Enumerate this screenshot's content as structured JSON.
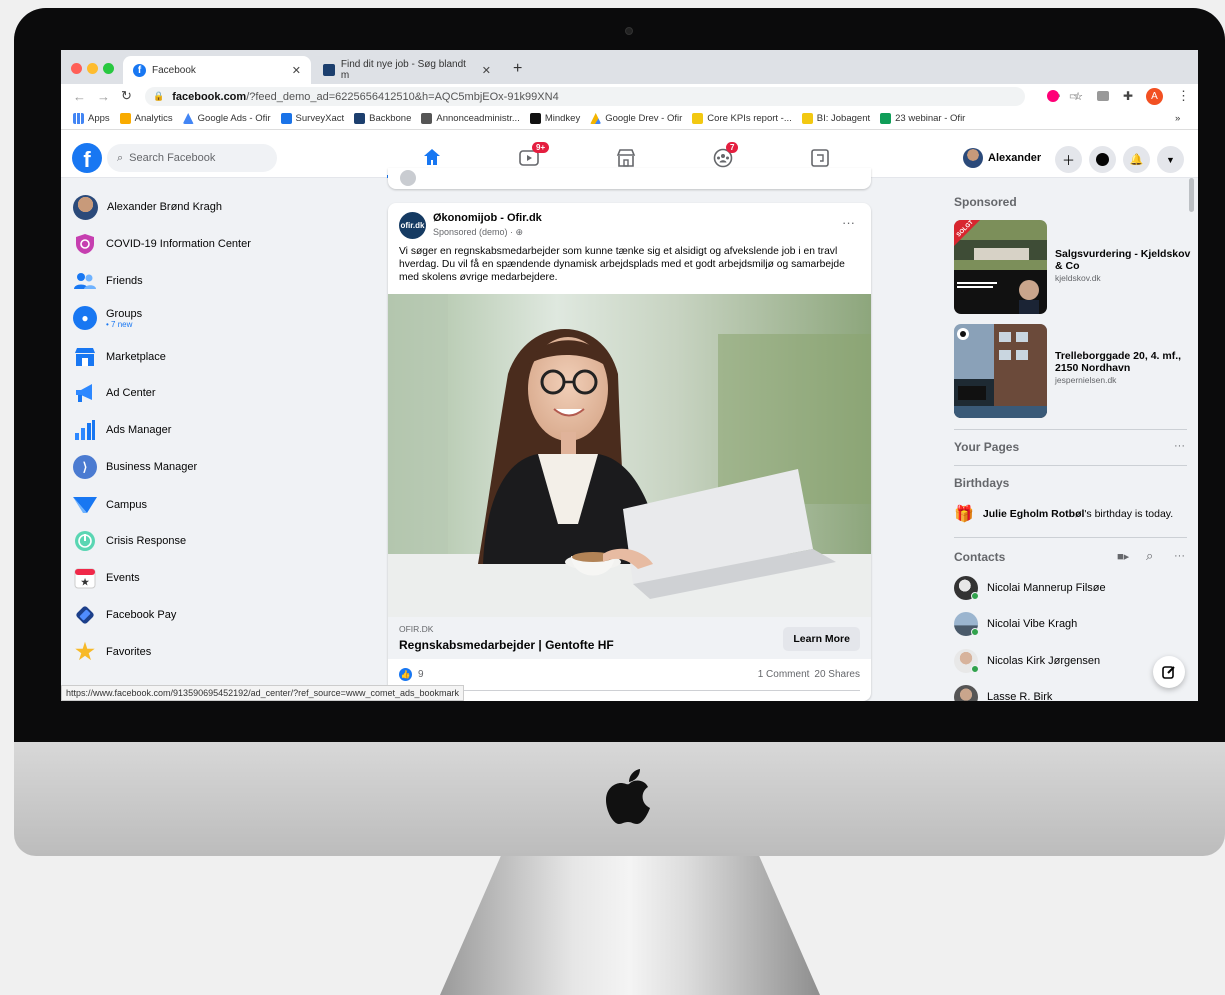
{
  "browser": {
    "tabs": [
      {
        "title": "Facebook",
        "active": true
      },
      {
        "title": "Find dit nye job - Søg blandt m",
        "active": false
      }
    ],
    "new_tab": "+",
    "url_host": "facebook.com",
    "url_path": "/?feed_demo_ad=6225656412510&h=AQC5mbjEOx-91k99XN4",
    "profile_initial": "A",
    "bookmarks": [
      "Apps",
      "Analytics",
      "Google Ads - Ofir",
      "SurveyXact",
      "Backbone",
      "Annonceadministr...",
      "Mindkey",
      "Google Drev - Ofir",
      "Core KPIs report -...",
      "BI: Jobagent",
      "23 webinar - Ofir"
    ],
    "bookmarks_more": "»",
    "status_url": "https://www.facebook.com/913590695452192/ad_center/?ref_source=www_comet_ads_bookmark"
  },
  "header": {
    "search_placeholder": "Search Facebook",
    "watch_badge": "9+",
    "groups_badge": "7",
    "user_name": "Alexander"
  },
  "sidebar": {
    "items": [
      {
        "label": "Alexander Brønd Kragh"
      },
      {
        "label": "COVID-19 Information Center"
      },
      {
        "label": "Friends"
      },
      {
        "label": "Groups",
        "sub": "• 7 new"
      },
      {
        "label": "Marketplace"
      },
      {
        "label": "Ad Center"
      },
      {
        "label": "Ads Manager"
      },
      {
        "label": "Business Manager"
      },
      {
        "label": "Campus"
      },
      {
        "label": "Crisis Response"
      },
      {
        "label": "Events"
      },
      {
        "label": "Facebook Pay"
      },
      {
        "label": "Favorites"
      }
    ]
  },
  "post": {
    "page_logo_text": "ofir.dk",
    "page_name": "Økonomijob - Ofir.dk",
    "meta": "Sponsored (demo) · ",
    "more": "···",
    "body": "Vi søger en regnskabsmedarbejder som kunne tænke sig et alsidigt og afvekslende job i en travl hverdag. Du vil få en spændende dynamisk arbejdsplads med et godt arbejdsmiljø og samarbejde med skolens øvrige medarbejdere.",
    "link_domain": "OFIR.DK",
    "link_title": "Regnskabsmedarbejder | Gentofte HF",
    "cta": "Learn More",
    "reactions": "9",
    "comments": "1 Comment",
    "shares": "20 Shares"
  },
  "right": {
    "sponsored_title": "Sponsored",
    "ads": [
      {
        "title": "Salgsvurdering - Kjeldskov & Co",
        "domain": "kjeldskov.dk",
        "ribbon": "SOLGT"
      },
      {
        "title": "Trelleborggade 20, 4. mf., 2150 Nordhavn",
        "domain": "jespernielsen.dk"
      }
    ],
    "pages_title": "Your Pages",
    "pages_more": "···",
    "birthdays_title": "Birthdays",
    "birthday_name": "Julie Egholm Rotbøl",
    "birthday_text": "'s birthday is today.",
    "contacts_title": "Contacts",
    "contacts_more": "···",
    "contacts": [
      {
        "name": "Nicolai Mannerup Filsøe"
      },
      {
        "name": "Nicolai Vibe Kragh"
      },
      {
        "name": "Nicolas Kirk Jørgensen"
      },
      {
        "name": "Lasse R. Birk"
      }
    ]
  },
  "colors": {
    "brand": "#1877f2",
    "badge": "#e41e3f",
    "online": "#31a24c"
  }
}
